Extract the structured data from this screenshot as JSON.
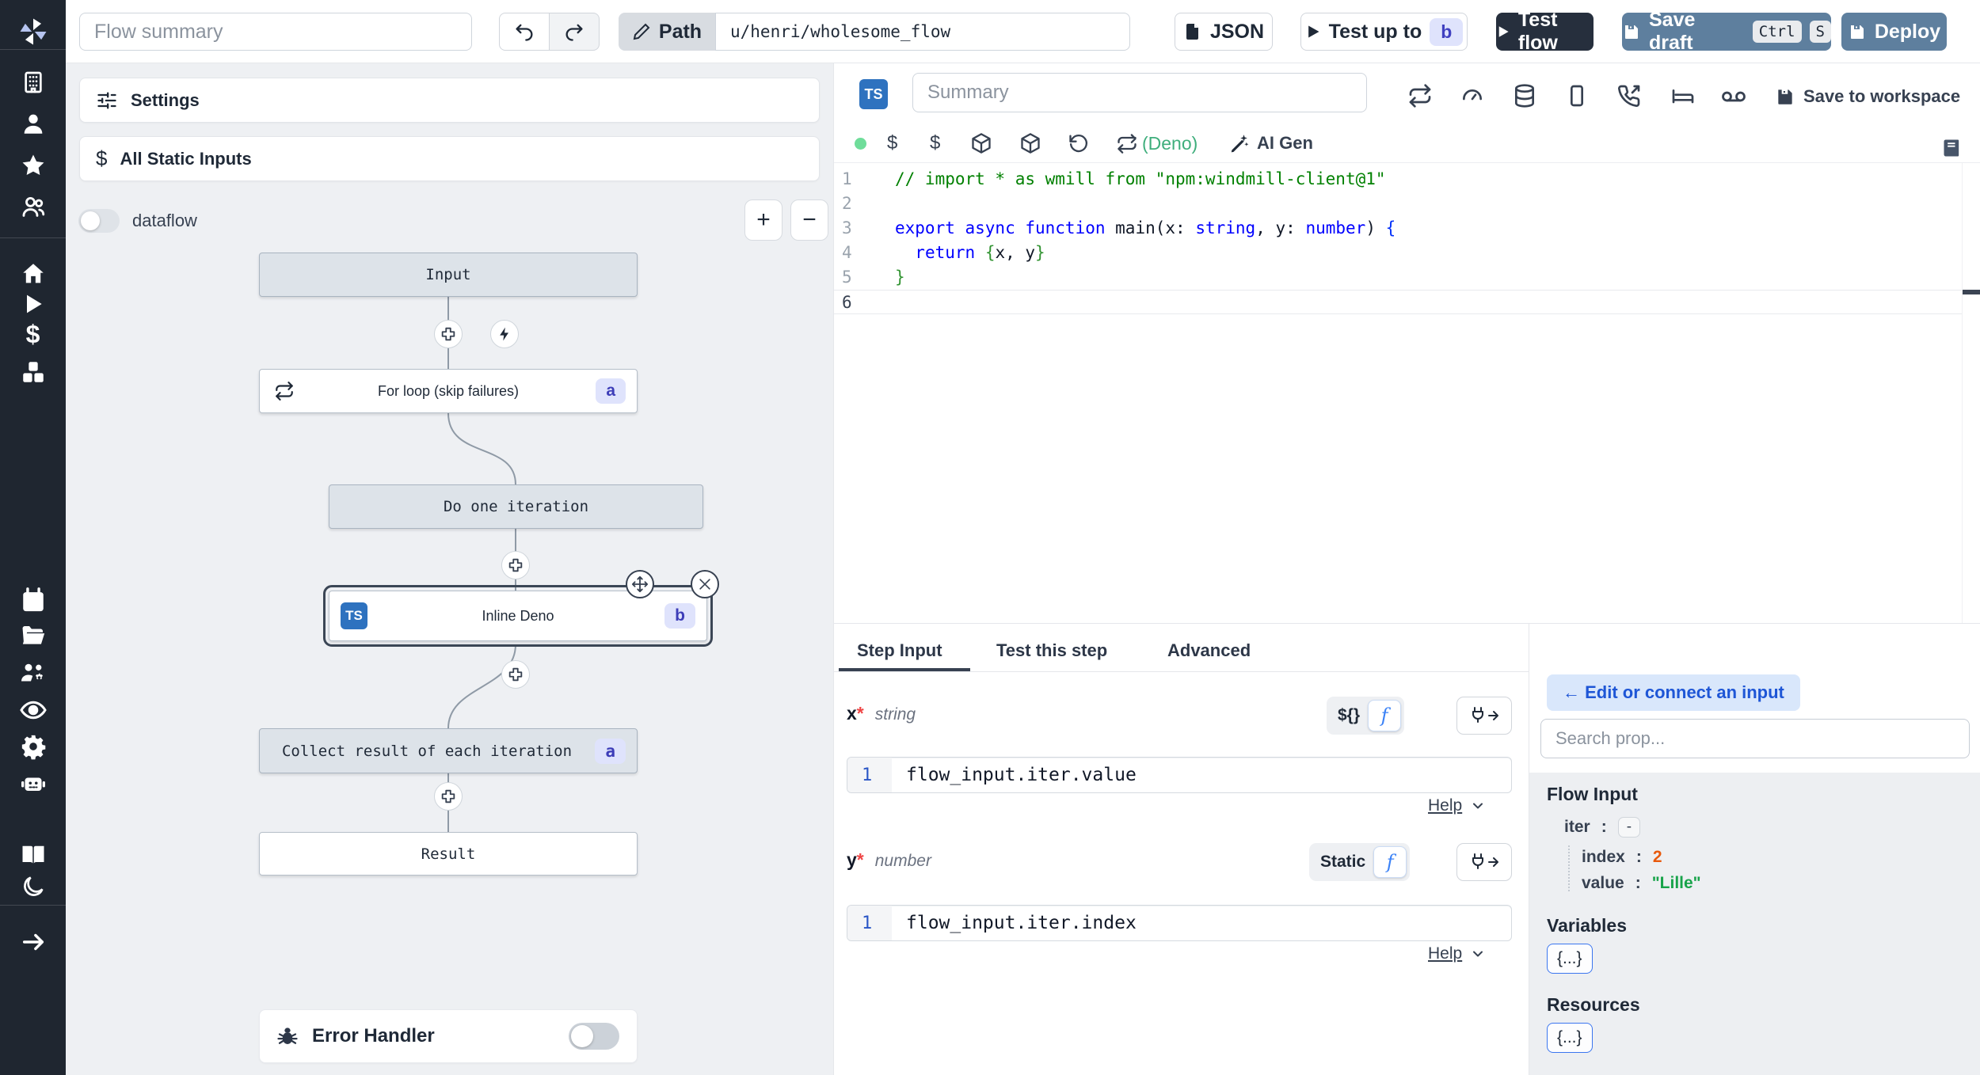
{
  "topbar": {
    "flow_summary_placeholder": "Flow summary",
    "path_label": "Path",
    "path_value": "u/henri/wholesome_flow",
    "json_label": "JSON",
    "test_up_to_label": "Test up to",
    "test_up_to_badge": "b",
    "test_flow_label": "Test flow",
    "save_draft_label": "Save draft",
    "kbd_ctrl": "Ctrl",
    "kbd_s": "S",
    "deploy_label": "Deploy"
  },
  "sidebar": {
    "icons_top": [
      "windmill-logo",
      "building",
      "user",
      "star",
      "users"
    ],
    "icons_mid": [
      "home",
      "play",
      "dollar",
      "boxes"
    ],
    "icons_lower": [
      "calendar",
      "folder-open",
      "users-gear",
      "eye",
      "gear",
      "robot"
    ],
    "icons_bottom": [
      "open-book",
      "moon",
      "arrow-right"
    ]
  },
  "flow_panel": {
    "settings_label": "Settings",
    "static_inputs_label": "All Static Inputs",
    "dataflow_label": "dataflow",
    "zoom_in": "+",
    "zoom_out": "−",
    "error_handler_label": "Error Handler",
    "nodes": {
      "input": {
        "label": "Input"
      },
      "forloop": {
        "label": "For loop (skip failures)",
        "badge": "a"
      },
      "iteration": {
        "label": "Do one iteration"
      },
      "inline": {
        "label": "Inline Deno",
        "badge": "b",
        "lang": "TS"
      },
      "collect": {
        "label": "Collect result of each iteration",
        "badge": "a"
      },
      "result": {
        "label": "Result"
      }
    }
  },
  "editor": {
    "lang_badge": "TS",
    "summary_placeholder": "Summary",
    "deno_label": "(Deno)",
    "ai_gen_label": "AI Gen",
    "save_to_workspace_label": "Save to workspace",
    "code": {
      "lines": [
        {
          "n": "1",
          "tokens": [
            {
              "t": "// import * as wmill from \"npm:windmill-client@1\"",
              "c": "cmt"
            }
          ]
        },
        {
          "n": "2",
          "tokens": []
        },
        {
          "n": "3",
          "tokens": [
            {
              "t": "export async function ",
              "c": "kw"
            },
            {
              "t": "main",
              "c": "plain"
            },
            {
              "t": "(",
              "c": "plain"
            },
            {
              "t": "x",
              "c": "plain"
            },
            {
              "t": ": ",
              "c": "plain"
            },
            {
              "t": "string",
              "c": "kw"
            },
            {
              "t": ", ",
              "c": "plain"
            },
            {
              "t": "y",
              "c": "plain"
            },
            {
              "t": ": ",
              "c": "plain"
            },
            {
              "t": "number",
              "c": "kw"
            },
            {
              "t": ") ",
              "c": "plain"
            },
            {
              "t": "{",
              "c": "bluebrace"
            }
          ]
        },
        {
          "n": "4",
          "tokens": [
            {
              "t": "  ",
              "c": "plain"
            },
            {
              "t": "return",
              "c": "kw"
            },
            {
              "t": " ",
              "c": "plain"
            },
            {
              "t": "{",
              "c": "brace"
            },
            {
              "t": "x, y",
              "c": "plain"
            },
            {
              "t": "}",
              "c": "brace"
            }
          ]
        },
        {
          "n": "5",
          "tokens": [
            {
              "t": "}",
              "c": "brace"
            }
          ]
        },
        {
          "n": "6",
          "tokens": []
        }
      ]
    }
  },
  "step_panel": {
    "tabs": [
      {
        "label": "Step Input"
      },
      {
        "label": "Test this step"
      },
      {
        "label": "Advanced"
      }
    ],
    "fields": [
      {
        "name": "x",
        "required": "*",
        "type": "string",
        "toggle_label": "${}",
        "line_no": "1",
        "expression": "flow_input.iter.value",
        "help_label": "Help"
      },
      {
        "name": "y",
        "required": "*",
        "type": "number",
        "toggle_label": "Static",
        "line_no": "1",
        "expression": "flow_input.iter.index",
        "help_label": "Help"
      }
    ]
  },
  "connect_panel": {
    "back_label": "← Edit or connect an input",
    "search_placeholder": "Search prop...",
    "flow_input_title": "Flow Input",
    "tree": {
      "iter_key": "iter",
      "colon": ":",
      "iter_toggle": "-",
      "index_key": "index",
      "index_value": "2",
      "value_key": "value",
      "value_value": "\"Lille\""
    },
    "variables_title": "Variables",
    "variables_chip": "{...}",
    "resources_title": "Resources",
    "resources_chip": "{...}"
  },
  "colors": {
    "sidebar_bg": "#1f2630",
    "steel_button": "#5e7f9e",
    "dark_button": "#262f3d",
    "badge_bg": "#dfe3fc",
    "badge_text": "#4040c0",
    "ts_blue": "#2e72bf",
    "deno_green": "#3fae7c",
    "index_orange": "#e8590c",
    "value_green": "#18a34a",
    "connect_pill_bg": "#d9e7fb",
    "connect_pill_text": "#1e56d6"
  }
}
